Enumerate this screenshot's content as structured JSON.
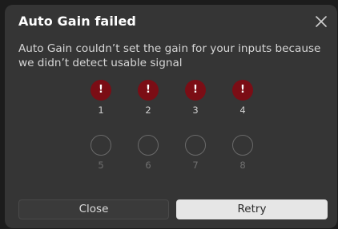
{
  "dialog": {
    "title": "Auto Gain failed",
    "close_icon": "close-icon",
    "message": "Auto Gain couldn’t set the gain for your inputs because we didn’t detect usable signal"
  },
  "inputs": [
    {
      "number": "1",
      "status": "failed",
      "icon": "exclamation-icon",
      "symbol": "!"
    },
    {
      "number": "2",
      "status": "failed",
      "icon": "exclamation-icon",
      "symbol": "!"
    },
    {
      "number": "3",
      "status": "failed",
      "icon": "exclamation-icon",
      "symbol": "!"
    },
    {
      "number": "4",
      "status": "failed",
      "icon": "exclamation-icon",
      "symbol": "!"
    },
    {
      "number": "5",
      "status": "inactive"
    },
    {
      "number": "6",
      "status": "inactive"
    },
    {
      "number": "7",
      "status": "inactive"
    },
    {
      "number": "8",
      "status": "inactive"
    }
  ],
  "buttons": {
    "close_label": "Close",
    "retry_label": "Retry"
  },
  "colors": {
    "dialog_background": "#353535",
    "failed_indicator": "#7b0d15",
    "primary_button": "#e6e6e6"
  }
}
